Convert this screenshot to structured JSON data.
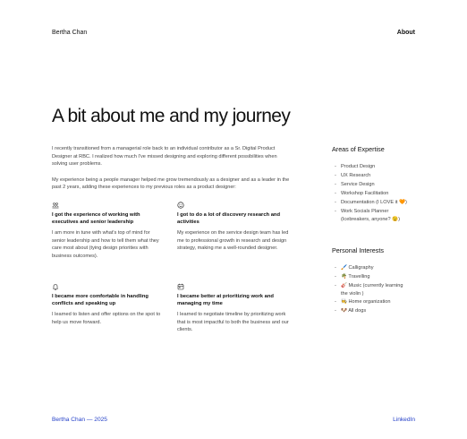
{
  "header": {
    "brand": "Bertha Chan",
    "nav_about": "About"
  },
  "main": {
    "title": "A bit about me and my journey",
    "paragraphs": [
      "I recently transitioned from a managerial role back to an individual contributor as a Sr. Digital Product Designer at RBC. I realized how much I've missed designing and exploring different possibilities when solving user problems.",
      "My experience being a people manager helped me grow tremendously as a designer and as a leader in the past 2 years, adding these experiences to my previous roles as a product designer:"
    ],
    "cards": [
      {
        "icon": "team-icon",
        "title": "I got the experience of working with executives and senior leadership",
        "body": "I am more in tune with what's top of mind for senior leadership and how to tell them what they care most about (tying design priorities with business outcomes)."
      },
      {
        "icon": "smile-icon",
        "title": "I got to do a lot of discovery research and activities",
        "body": "My experience on the service design team has led me to professional growth in research and design strategy, making me a well-rounded designer."
      },
      {
        "icon": "bell-icon",
        "title": "I became more comfortable in handling conflicts and speaking up",
        "body": "I learned to listen and offer options on the spot to help us move forward."
      },
      {
        "icon": "calendar-icon",
        "title": "I became better at prioritizing work and managing my time",
        "body": "I learned to negotiate timeline by prioritizing work that is most impactful to both the business and our clients."
      }
    ]
  },
  "sidebar": {
    "expertise_heading": "Areas of Expertise",
    "expertise": [
      "Product Design",
      "UX Research",
      "Service Design",
      "Workshop Facilitation",
      "Documentation (I LOVE it 🧡)",
      "Work Socials Planner",
      "(Icebreakers, anyone? 😉)"
    ],
    "interests_heading": "Personal Interests",
    "interests": [
      "🖌️ Calligraphy",
      "🌴 Travelling",
      "🎸 Music (currently learning",
      "the violin )",
      "🧑‍🍳 Home organization",
      "🐶 All dogs"
    ]
  },
  "footer": {
    "copyright": "Bertha Chan — 2025",
    "linkedin": "LinkedIn"
  },
  "colors": {
    "footer_link": "#2440c8",
    "text": "#111111",
    "body_text": "#444444"
  }
}
